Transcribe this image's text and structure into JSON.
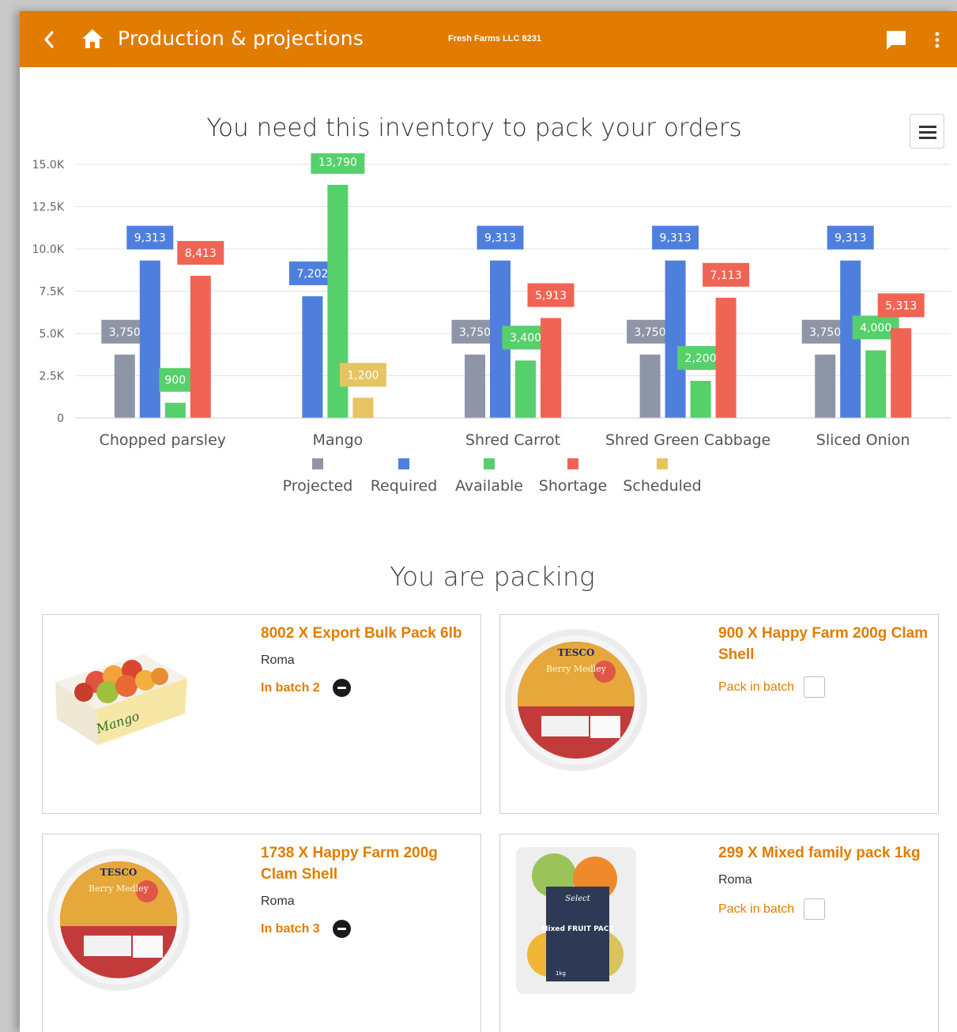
{
  "header": {
    "title": "Production & projections",
    "company": "Fresh Farms LLC 8231"
  },
  "colors": {
    "header": "#e27c00",
    "projected": "#8e95a7",
    "required": "#4f7fdc",
    "available": "#55d06a",
    "shortage": "#f06454",
    "scheduled": "#e5c461"
  },
  "chart_data": {
    "type": "bar",
    "title": "You need this inventory to pack your orders",
    "categories": [
      "Chopped parsley",
      "Mango",
      "Shred Carrot",
      "Shred Green Cabbage",
      "Sliced Onion"
    ],
    "series": [
      {
        "name": "Projected",
        "values": [
          3750,
          null,
          3750,
          3750,
          3750
        ]
      },
      {
        "name": "Required",
        "values": [
          9313,
          7202,
          9313,
          9313,
          9313
        ]
      },
      {
        "name": "Available",
        "values": [
          900,
          13790,
          3400,
          2200,
          4000
        ]
      },
      {
        "name": "Shortage",
        "values": [
          8413,
          null,
          5913,
          7113,
          5313
        ]
      },
      {
        "name": "Scheduled",
        "values": [
          null,
          1200,
          null,
          null,
          null
        ]
      }
    ],
    "data_labels": [
      [
        "3,750",
        "9,313",
        "900",
        "8,413",
        ""
      ],
      [
        "",
        "7,202",
        "13,790",
        "",
        "1,200"
      ],
      [
        "3,750",
        "9,313",
        "3,400",
        "5,913",
        ""
      ],
      [
        "3,750",
        "9,313",
        "2,200",
        "7,113",
        ""
      ],
      [
        "3,750",
        "9,313",
        "4,000",
        "5,313",
        ""
      ]
    ],
    "y_ticks": [
      "0",
      "2.5K",
      "5.0K",
      "7.5K",
      "10.0K",
      "12.5K",
      "15.0K"
    ],
    "ylim": [
      0,
      15000
    ],
    "grid": true,
    "legend": "bottom-center"
  },
  "legend": {
    "items": [
      "Projected",
      "Required",
      "Available",
      "Shortage",
      "Scheduled"
    ]
  },
  "packing": {
    "title": "You are packing",
    "cards": [
      {
        "title": "8002 X Export Bulk Pack 6lb",
        "variety": "Roma",
        "batch": "In batch 2",
        "pack_label": ""
      },
      {
        "title": "900 X Happy Farm 200g Clam Shell",
        "variety": "",
        "batch": "",
        "pack_label": "Pack in batch"
      },
      {
        "title": "1738 X Happy Farm 200g Clam Shell",
        "variety": "Roma",
        "batch": "In batch 3",
        "pack_label": ""
      },
      {
        "title": "299 X Mixed family pack 1kg",
        "variety": "Roma",
        "batch": "",
        "pack_label": "Pack in batch"
      }
    ],
    "product_images": {
      "mango_box_text": "Mango",
      "tesco_brand": "TESCO",
      "tesco_product": "Berry Medley",
      "fruit_pack_brand": "Select",
      "fruit_pack_text": "Mixed FRUIT PACK",
      "fruit_pack_weight": "1kg"
    }
  }
}
